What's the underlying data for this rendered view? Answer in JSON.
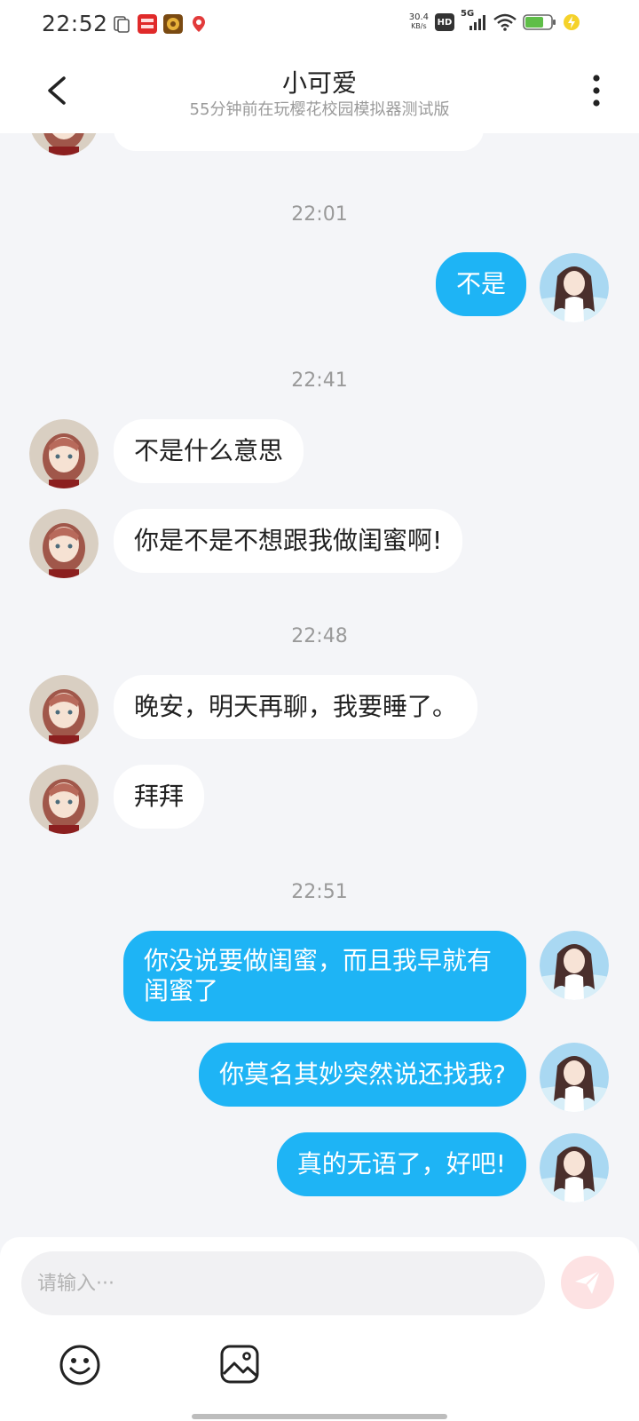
{
  "status_bar": {
    "time": "22:52",
    "net_speed_value": "30.4",
    "net_speed_unit": "KB/s",
    "hd_label": "HD",
    "network_label": "5G",
    "app_icons": [
      "document-icon",
      "red-app-icon",
      "game-app-icon",
      "map-pin-icon"
    ]
  },
  "header": {
    "title": "小可爱",
    "subtitle": "55分钟前在玩樱花校园模拟器测试版"
  },
  "messages": [
    {
      "type": "timestamp",
      "text": "22:01"
    },
    {
      "type": "outgoing",
      "text": "不是"
    },
    {
      "type": "timestamp",
      "text": "22:41"
    },
    {
      "type": "incoming",
      "text": "不是什么意思"
    },
    {
      "type": "incoming",
      "text": "你是不是不想跟我做闺蜜啊!"
    },
    {
      "type": "timestamp",
      "text": "22:48"
    },
    {
      "type": "incoming",
      "text": "晚安，明天再聊，我要睡了。"
    },
    {
      "type": "incoming",
      "text": "拜拜"
    },
    {
      "type": "timestamp",
      "text": "22:51"
    },
    {
      "type": "outgoing",
      "text": "你没说要做闺蜜，而且我早就有闺蜜了"
    },
    {
      "type": "outgoing",
      "text": "你莫名其妙突然说还找我?"
    },
    {
      "type": "outgoing",
      "text": "真的无语了，好吧!"
    }
  ],
  "composer": {
    "placeholder": "请输入···"
  },
  "colors": {
    "accent": "#1eb4f5",
    "background": "#f4f5f8",
    "send_button": "#fde2e3"
  }
}
